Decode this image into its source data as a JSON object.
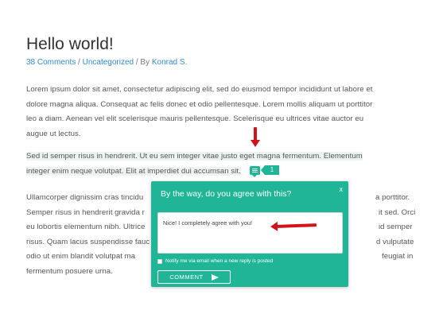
{
  "post": {
    "title": "Hello world!",
    "comments_link": "38 Comments",
    "category_link": "Uncategorized",
    "author_prefix": "By",
    "author_link": "Konrad S."
  },
  "paragraphs": {
    "p1": [
      "Lorem ipsum dolor sit amet, consectetur adipiscing elit, sed do eiusmod tempor incididunt ut labore et",
      "dolore magna aliqua. Consequat ac felis donec et odio pellentesque. Lorem mollis aliquam ut porttitor",
      "leo a diam. Aenean vel elit scelerisque mauris pellentesque. Scelerisque eu ultrices vitae auctor eu",
      "augue ut lectus."
    ],
    "p2": [
      "Sed id semper risus in hendrerit. Ut eu sem integer vitae justo eget magna fermentum. Elementum",
      "integer enim neque volutpat. Elit at imperdiet dui accumsan sit."
    ],
    "p3_left": [
      "Ullamcorper dignissim cras tincidu",
      "Semper risus in hendrerit gravida r",
      "eu lobortis elementum nibh. Ultrice",
      "risus. Quam lacus suspendisse fauc",
      "odio ut enim blandit volutpat ma",
      "fermentum posuere urna."
    ],
    "p3_right": [
      "a porttitor.",
      "it sed. Orci",
      "id semper",
      "d vulputate",
      "feugiat in",
      ""
    ]
  },
  "inline_comment": {
    "count": "1"
  },
  "popup": {
    "title": "By the way, do you agree with this?",
    "close": "x",
    "textarea_value": "Nice! I completely agree with you!",
    "notify_label": "Notify me via email when a new reply is posted",
    "submit_label": "COMMENT"
  },
  "colors": {
    "accent": "#1fb596",
    "link": "#2e8bd0",
    "arrow": "#d0141b"
  }
}
